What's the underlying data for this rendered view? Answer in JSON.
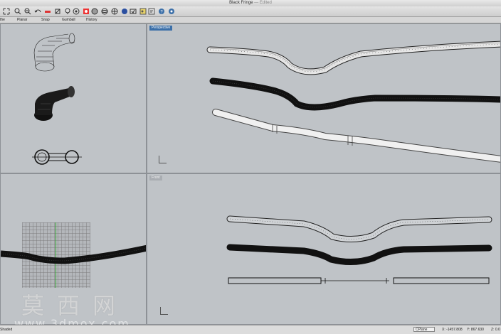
{
  "window": {
    "title": "Black Fringe",
    "edited": "— Edited"
  },
  "toolbar": {
    "icons": [
      "zoom-extents-icon",
      "pan-icon",
      "zoom-window-icon",
      "undo-icon",
      "ruler-icon",
      "point-icon",
      "lasso-icon",
      "layer-icon",
      "select-icon",
      "sphere-icon",
      "render-icon",
      "globe-icon",
      "lock-icon",
      "camera-icon",
      "properties-icon",
      "help-icon",
      "info-icon"
    ]
  },
  "tabs": [
    "the",
    "Planar",
    "Snap",
    "Gumball",
    "History"
  ],
  "viewports": {
    "perspective": {
      "label": "Perspective"
    },
    "front": {
      "label": "Front"
    }
  },
  "status": {
    "left": "Shaded",
    "cplane": "CPlane",
    "x": "X: -1457.808",
    "y": "Y: 867.630",
    "z": "Z: 0.0"
  },
  "watermark": {
    "text": "莫西网",
    "url": "www.3dmox.com"
  }
}
